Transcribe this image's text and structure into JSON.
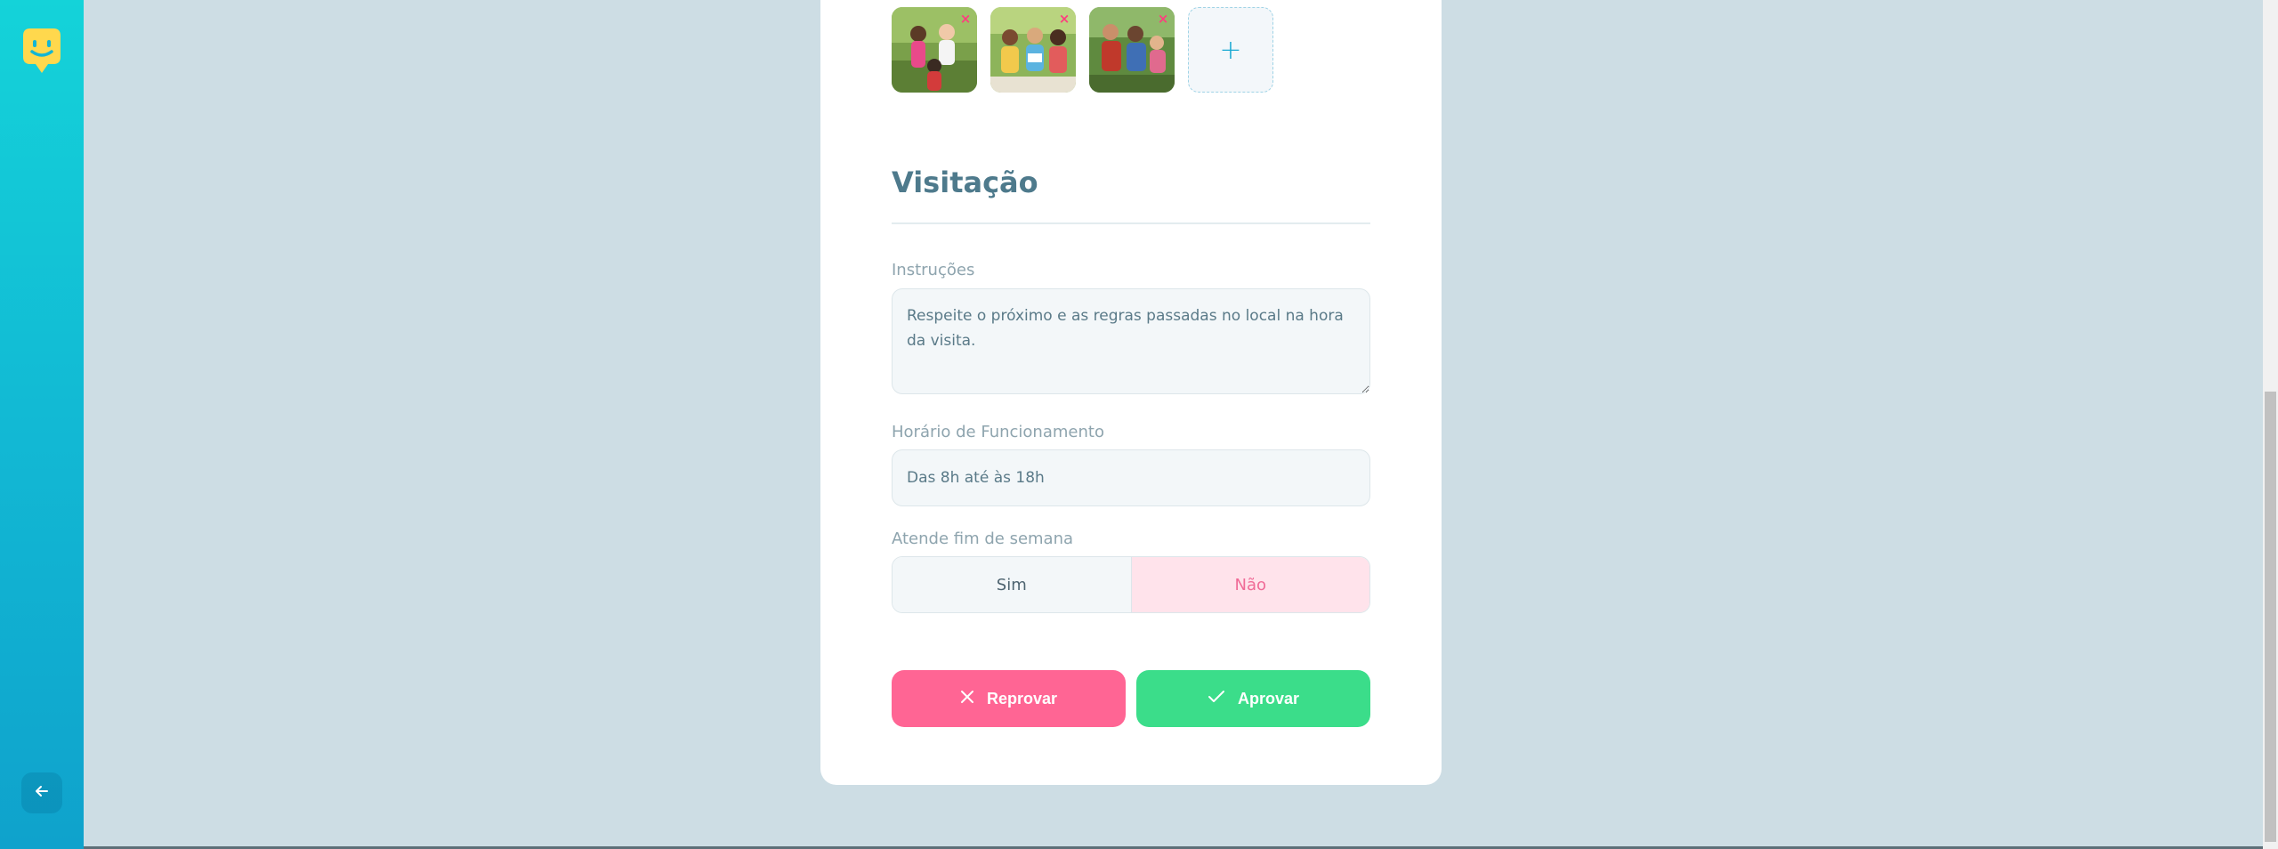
{
  "sidebar": {
    "logo_icon": "smiley-chat-logo",
    "back_icon": "arrow-left-icon"
  },
  "photos": {
    "items": [
      {
        "alt": "children-playing-photo",
        "remove_label": "×"
      },
      {
        "alt": "children-reading-photo",
        "remove_label": "×"
      },
      {
        "alt": "family-outdoors-photo",
        "remove_label": "×"
      }
    ],
    "add_label": "+"
  },
  "visitation": {
    "title": "Visitação",
    "instructions_label": "Instruções",
    "instructions_value": "Respeite o próximo e as regras passadas no local na hora da visita.",
    "hours_label": "Horário de Funcionamento",
    "hours_value": "Das 8h até às 18h",
    "weekend_label": "Atende fim de semana",
    "weekend_yes": "Sim",
    "weekend_no": "Não",
    "weekend_selected": "Não"
  },
  "actions": {
    "reject_label": "Reprovar",
    "approve_label": "Aprovar"
  },
  "colors": {
    "sidebar": "#14c3d8",
    "reject": "#ff6594",
    "approve": "#3bdd8a",
    "selected_no": "#ffe3eb",
    "title": "#4e7a8c"
  }
}
